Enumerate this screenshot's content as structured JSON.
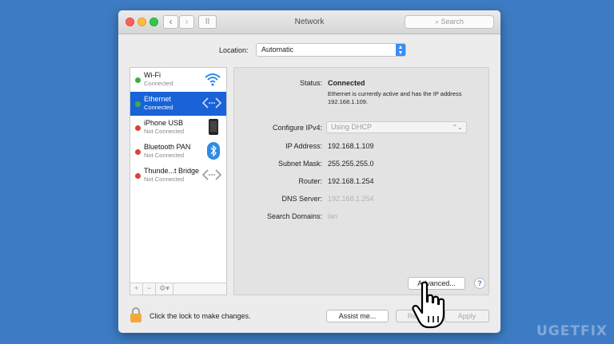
{
  "window": {
    "title": "Network"
  },
  "toolbar": {
    "back": "‹",
    "forward": "›",
    "grid": "⠿",
    "search_placeholder": "Search"
  },
  "location": {
    "label": "Location:",
    "value": "Automatic"
  },
  "services": [
    {
      "name": "Wi-Fi",
      "state": "Connected",
      "dot": "#3cb043",
      "icon": "wifi-icon",
      "selected": false
    },
    {
      "name": "Ethernet",
      "state": "Connected",
      "dot": "#3cb043",
      "icon": "ethernet-icon",
      "selected": true
    },
    {
      "name": "iPhone USB",
      "state": "Not Connected",
      "dot": "#e0403a",
      "icon": "iphone-icon",
      "selected": false
    },
    {
      "name": "Bluetooth PAN",
      "state": "Not Connected",
      "dot": "#e0403a",
      "icon": "bluetooth-icon",
      "selected": false
    },
    {
      "name": "Thunde...t Bridge",
      "state": "Not Connected",
      "dot": "#e0403a",
      "icon": "thunderbolt-bridge-icon",
      "selected": false
    }
  ],
  "sidebar_toolbar": {
    "add": "+",
    "remove": "−",
    "gear": "⚙▾"
  },
  "detail": {
    "status_label": "Status:",
    "status_value": "Connected",
    "status_desc": "Ethernet is currently active and has the IP address 192.168.1.109.",
    "configure_label": "Configure IPv4:",
    "configure_value": "Using DHCP",
    "ip_label": "IP Address:",
    "ip_value": "192.168.1.109",
    "subnet_label": "Subnet Mask:",
    "subnet_value": "255.255.255.0",
    "router_label": "Router:",
    "router_value": "192.168.1.254",
    "dns_label": "DNS Server:",
    "dns_value": "192.168.1.254",
    "search_label": "Search Domains:",
    "search_value": "lan",
    "advanced_button": "Advanced...",
    "help": "?"
  },
  "footer": {
    "lock_text": "Click the lock to make changes.",
    "assist_button": "Assist me...",
    "revert_button": "Revert",
    "apply_button": "Apply"
  },
  "watermark": "UGETFIX",
  "colors": {
    "background": "#3d7cc4",
    "selection": "#1a62d7",
    "accent": "#3b8cf5"
  }
}
